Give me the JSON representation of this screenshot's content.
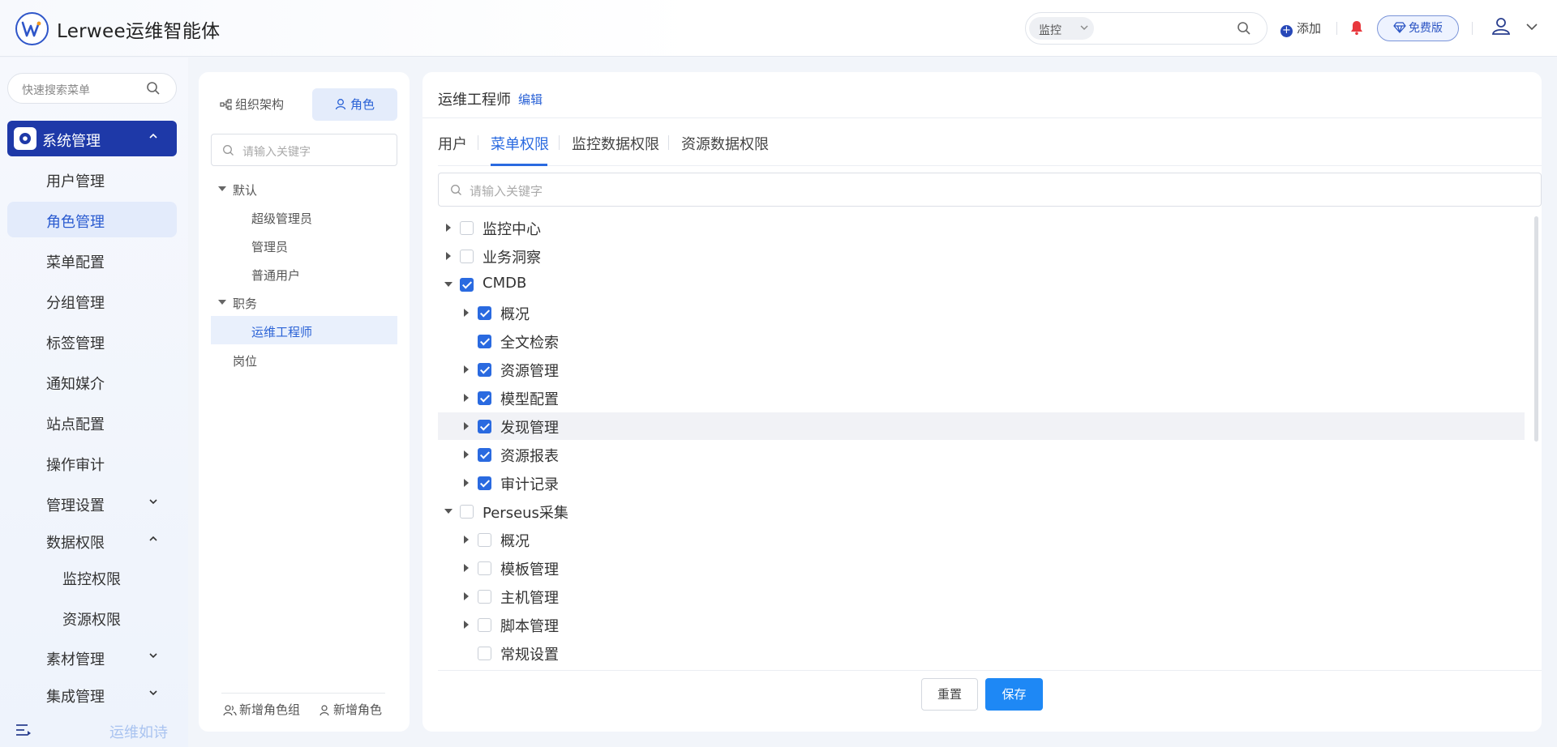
{
  "header": {
    "app_title": "Lerwee运维智能体",
    "search_scope": "监控",
    "add_label": "添加",
    "free_label": "免费版"
  },
  "nav": {
    "search_placeholder": "快速搜索菜单",
    "system_label": "系统管理",
    "items": [
      {
        "label": "用户管理"
      },
      {
        "label": "角色管理"
      },
      {
        "label": "菜单配置"
      },
      {
        "label": "分组管理"
      },
      {
        "label": "标签管理"
      },
      {
        "label": "通知媒介"
      },
      {
        "label": "站点配置"
      },
      {
        "label": "操作审计"
      },
      {
        "label": "管理设置"
      },
      {
        "label": "数据权限"
      },
      {
        "label": "监控权限"
      },
      {
        "label": "资源权限"
      },
      {
        "label": "素材管理"
      },
      {
        "label": "集成管理"
      }
    ],
    "bottom_text": "运维如诗"
  },
  "roles_panel": {
    "tab_org": "组织架构",
    "tab_role": "角色",
    "search_placeholder": "请输入关键字",
    "tree": [
      {
        "label": "默认"
      },
      {
        "label": "超级管理员"
      },
      {
        "label": "管理员"
      },
      {
        "label": "普通用户"
      },
      {
        "label": "职务"
      },
      {
        "label": "运维工程师"
      },
      {
        "label": "岗位"
      }
    ],
    "add_group_label": "新增角色组",
    "add_role_label": "新增角色"
  },
  "detail": {
    "role_title": "运维工程师",
    "edit_label": "编辑",
    "tabs": [
      "用户",
      "菜单权限",
      "监控数据权限",
      "资源数据权限"
    ],
    "active_tab": "菜单权限",
    "search_placeholder": "请输入关键字",
    "tree": [
      {
        "label": "监控中心",
        "level": 0,
        "expandable": true,
        "expanded": false,
        "checked": false
      },
      {
        "label": "业务洞察",
        "level": 0,
        "expandable": true,
        "expanded": false,
        "checked": false
      },
      {
        "label": "CMDB",
        "level": 0,
        "expandable": true,
        "expanded": true,
        "checked": true
      },
      {
        "label": "概况",
        "level": 1,
        "expandable": true,
        "expanded": false,
        "checked": true
      },
      {
        "label": "全文检索",
        "level": 1,
        "expandable": false,
        "expanded": false,
        "checked": true
      },
      {
        "label": "资源管理",
        "level": 1,
        "expandable": true,
        "expanded": false,
        "checked": true
      },
      {
        "label": "模型配置",
        "level": 1,
        "expandable": true,
        "expanded": false,
        "checked": true
      },
      {
        "label": "发现管理",
        "level": 1,
        "expandable": true,
        "expanded": false,
        "checked": true
      },
      {
        "label": "资源报表",
        "level": 1,
        "expandable": true,
        "expanded": false,
        "checked": true
      },
      {
        "label": "审计记录",
        "level": 1,
        "expandable": true,
        "expanded": false,
        "checked": true
      },
      {
        "label": "Perseus采集",
        "level": 0,
        "expandable": true,
        "expanded": true,
        "checked": false
      },
      {
        "label": "概况",
        "level": 1,
        "expandable": true,
        "expanded": false,
        "checked": false
      },
      {
        "label": "模板管理",
        "level": 1,
        "expandable": true,
        "expanded": false,
        "checked": false
      },
      {
        "label": "主机管理",
        "level": 1,
        "expandable": true,
        "expanded": false,
        "checked": false
      },
      {
        "label": "脚本管理",
        "level": 1,
        "expandable": true,
        "expanded": false,
        "checked": false
      },
      {
        "label": "常规设置",
        "level": 1,
        "expandable": false,
        "expanded": false,
        "checked": false
      }
    ],
    "reset_label": "重置",
    "save_label": "保存"
  },
  "colors": {
    "brand": "#1e39a8",
    "accent": "#2a6ae0",
    "save_button": "#1e88f5",
    "alert_bell": "#e8383d"
  },
  "icons": [
    "lerwee-logo-icon",
    "search-icon",
    "chevron-down-icon",
    "plus-circle-icon",
    "bell-icon",
    "diamond-icon",
    "user-icon",
    "gear-icon",
    "org-chart-icon",
    "role-icon",
    "caret-right-icon",
    "caret-down-icon",
    "menu-fold-icon",
    "add-group-icon",
    "add-user-icon"
  ]
}
